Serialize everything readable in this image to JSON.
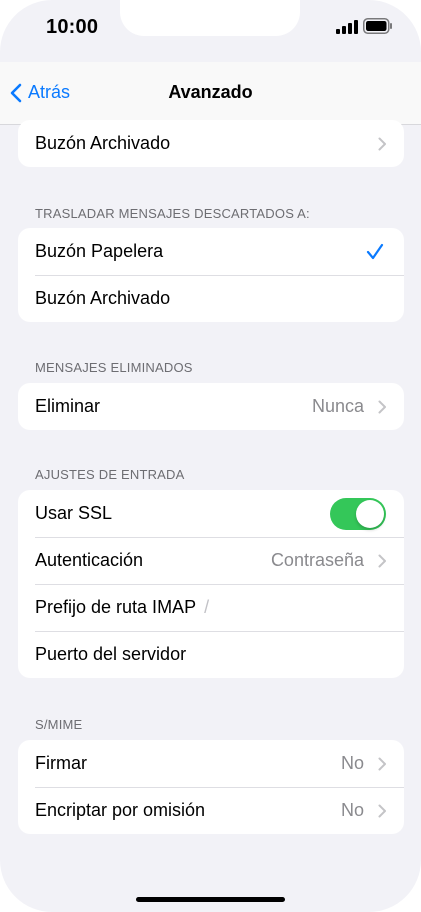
{
  "status_bar": {
    "time": "10:00"
  },
  "nav": {
    "back_label": "Atrás",
    "title": "Avanzado"
  },
  "sections": {
    "archive_top": {
      "row": "Buzón Archivado"
    },
    "move_discarded": {
      "header": "TRASLADAR MENSAJES DESCARTADOS A:",
      "rows": [
        "Buzón Papelera",
        "Buzón Archivado"
      ],
      "selected_index": 0
    },
    "deleted": {
      "header": "MENSAJES ELIMINADOS",
      "row_label": "Eliminar",
      "row_value": "Nunca"
    },
    "incoming": {
      "header": "AJUSTES DE ENTRADA",
      "ssl_label": "Usar SSL",
      "ssl_on": true,
      "auth_label": "Autenticación",
      "auth_value": "Contraseña",
      "imap_prefix_label": "Prefijo de ruta IMAP",
      "imap_prefix_value": "/",
      "port_label": "Puerto del servidor"
    },
    "smime": {
      "header": "S/MIME",
      "sign_label": "Firmar",
      "sign_value": "No",
      "encrypt_label": "Encriptar por omisión",
      "encrypt_value": "No"
    }
  },
  "colors": {
    "accent": "#0a7aff",
    "toggle_on": "#34c759",
    "background": "#f2f2f7"
  }
}
